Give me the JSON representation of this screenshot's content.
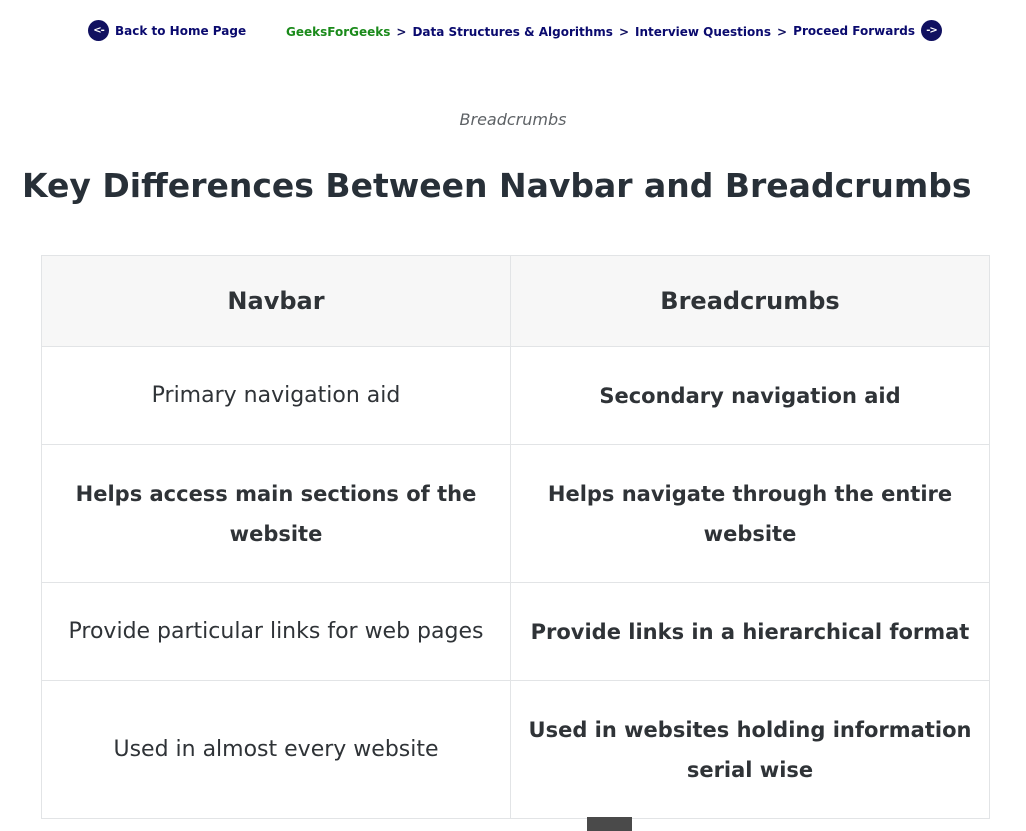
{
  "breadcrumb_figure": {
    "back_label": "Back to Home Page",
    "back_arrow": "<-",
    "trail": [
      "GeeksForGeeks",
      "Data Structures & Algorithms",
      "Interview Questions"
    ],
    "separator": ">",
    "forward_label": "Proceed Forwards",
    "forward_arrow": "->",
    "colors": {
      "navy": "#101060",
      "home_green": "#1a8a1a"
    }
  },
  "caption": "Breadcrumbs",
  "heading": "Key Differences Between Navbar and Breadcrumbs",
  "table": {
    "headers": [
      "Navbar",
      "Breadcrumbs"
    ],
    "rows": [
      [
        "Primary navigation aid",
        "Secondary navigation aid"
      ],
      [
        "Helps access main sections of the website",
        "Helps navigate through the entire website"
      ],
      [
        "Provide particular links for web pages",
        "Provide links in a hierarchical format"
      ],
      [
        "Used in almost every website",
        "Used in websites holding information serial wise"
      ]
    ]
  }
}
